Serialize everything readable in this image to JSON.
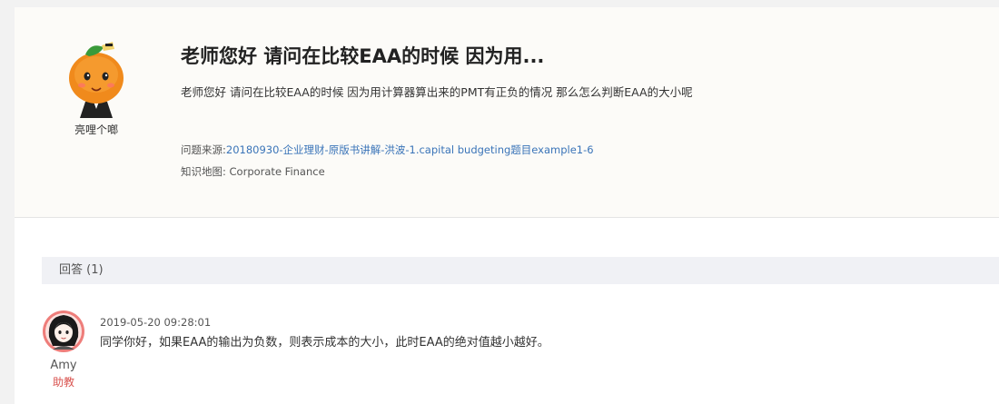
{
  "question": {
    "asker_name": "亮哩个啷",
    "title": "老师您好 请问在比较EAA的时候 因为用...",
    "body": "老师您好 请问在比较EAA的时候 因为用计算器算出来的PMT有正负的情况 那么怎么判断EAA的大小呢",
    "source_label": "问题来源:",
    "source_link": "20180930-企业理财-原版书讲解-洪波-1.capital budgeting题目example1-6",
    "knowledge_label": "知识地图:",
    "knowledge_value": "Corporate Finance"
  },
  "answers_section": {
    "header": "回答 (1)"
  },
  "answers": [
    {
      "author": "Amy",
      "role": "助教",
      "time": "2019-05-20 09:28:01",
      "text": "同学你好，如果EAA的输出为负数，则表示成本的大小，此时EAA的绝对值越小越好。"
    }
  ],
  "colors": {
    "link": "#3a74b8",
    "role": "#d9534f",
    "avatar_ring": "#ee7d7a",
    "orange": "#f08a1c"
  }
}
